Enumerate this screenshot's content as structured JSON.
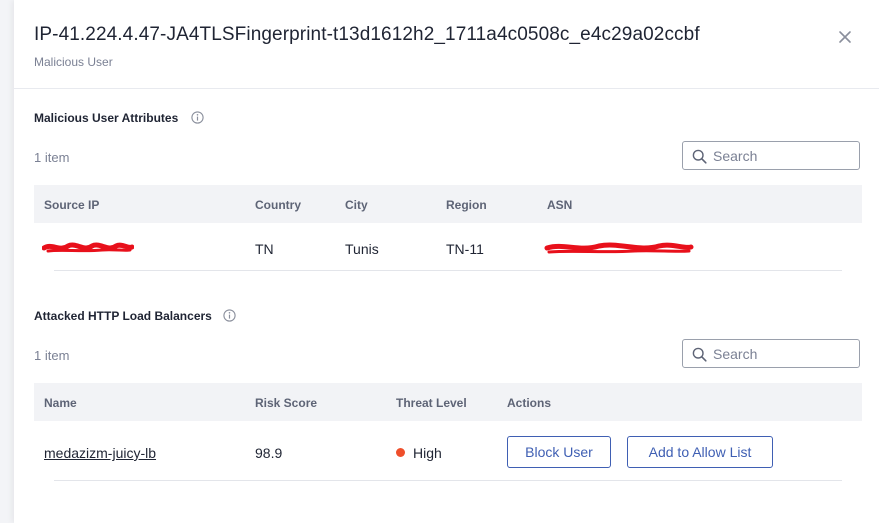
{
  "panel": {
    "title": "IP-41.224.4.47-JA4TLSFingerprint-t13d1612h2_1711a4c0508c_e4c29a02ccbf",
    "subtitle": "Malicious User"
  },
  "attributes": {
    "title": "Malicious User Attributes",
    "count": "1 item",
    "search_placeholder": "Search",
    "columns": [
      "Source IP",
      "Country",
      "City",
      "Region",
      "ASN"
    ],
    "rows": [
      {
        "country": "TN",
        "city": "Tunis",
        "region": "TN-11"
      }
    ]
  },
  "load_balancers": {
    "title": "Attacked HTTP Load Balancers",
    "count": "1 item",
    "search_placeholder": "Search",
    "columns": [
      "Name",
      "Risk Score",
      "Threat Level",
      "Actions"
    ],
    "rows": [
      {
        "name": "medazizm-juicy-lb",
        "risk_score": "98.9",
        "threat_level": "High",
        "threat_color": "#ef4f2b",
        "actions": [
          "Block User",
          "Add to Allow List"
        ]
      }
    ]
  },
  "colors": {
    "accent": "#3f5fb3",
    "high": "#ef4f2b",
    "redaction": "#e8101b"
  },
  "icons": {
    "close": "close-icon",
    "info": "info-icon",
    "search": "search-icon"
  }
}
